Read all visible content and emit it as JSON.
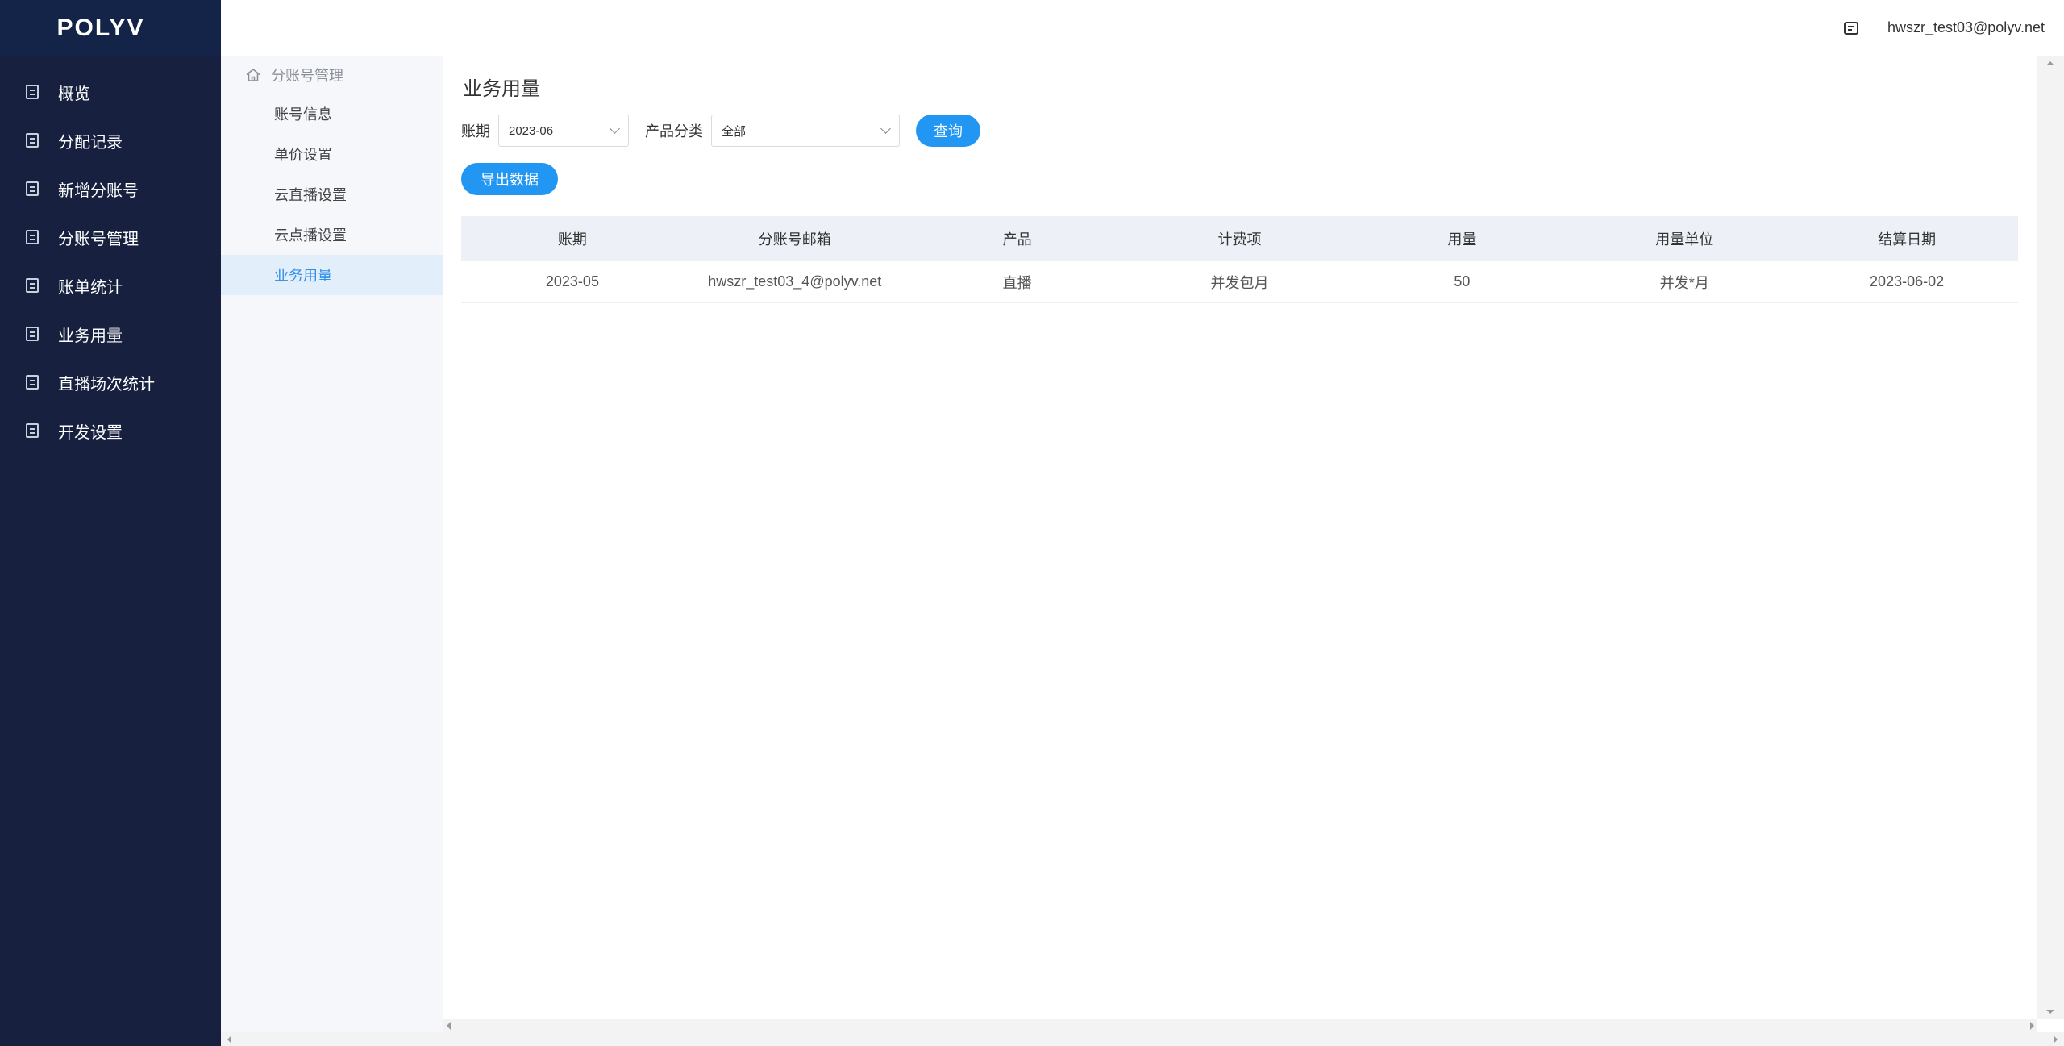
{
  "brand": {
    "logo_text": "POLYV"
  },
  "header": {
    "user_email": "hwszr_test03@polyv.net"
  },
  "sidebar": {
    "items": [
      {
        "label": "概览"
      },
      {
        "label": "分配记录"
      },
      {
        "label": "新增分账号"
      },
      {
        "label": "分账号管理"
      },
      {
        "label": "账单统计"
      },
      {
        "label": "业务用量"
      },
      {
        "label": "直播场次统计"
      },
      {
        "label": "开发设置"
      }
    ]
  },
  "subnav": {
    "title": "分账号管理",
    "items": [
      {
        "label": "账号信息"
      },
      {
        "label": "单价设置"
      },
      {
        "label": "云直播设置"
      },
      {
        "label": "云点播设置"
      },
      {
        "label": "业务用量"
      }
    ]
  },
  "main": {
    "title": "业务用量",
    "filters": {
      "period_label": "账期",
      "period_value": "2023-06",
      "category_label": "产品分类",
      "category_value": "全部",
      "query_label": "查询"
    },
    "export_label": "导出数据",
    "table": {
      "columns": [
        "账期",
        "分账号邮箱",
        "产品",
        "计费项",
        "用量",
        "用量单位",
        "结算日期"
      ],
      "rows": [
        [
          "2023-05",
          "hwszr_test03_4@polyv.net",
          "直播",
          "并发包月",
          "50",
          "并发*月",
          "2023-06-02"
        ]
      ]
    }
  }
}
